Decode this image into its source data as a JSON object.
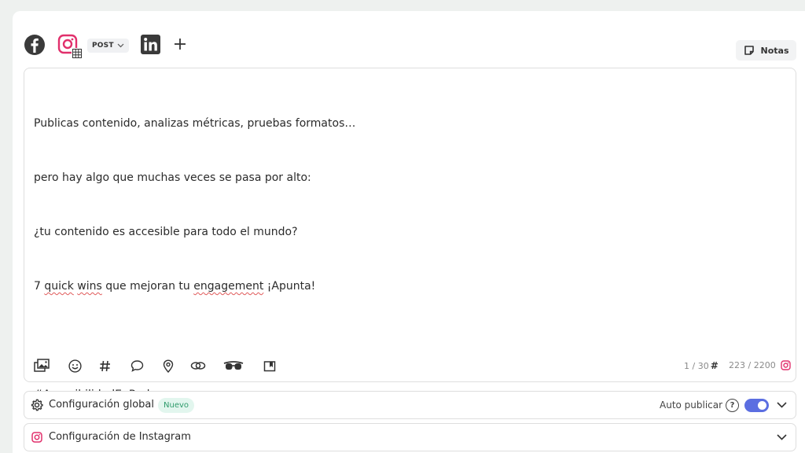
{
  "networks": {
    "facebook_icon": "facebook-icon",
    "instagram_icon": "instagram-icon",
    "instagram_color": "#e1306c",
    "post_type_label": "POST",
    "linkedin_icon": "linkedin-icon",
    "add_icon": "plus-icon"
  },
  "notes_button": {
    "label": "Notas"
  },
  "editor": {
    "lines": [
      "Publicas contenido, analizas métricas, pruebas formatos…",
      "pero hay algo que muchas veces se pasa por alto:",
      "¿tu contenido es accesible para todo el mundo?",
      "7 quick wins que mejoran tu engagement ¡Apunta!",
      "",
      "#AccesibilidadEnRedes"
    ],
    "line4_parts": [
      "7 ",
      "quick",
      " ",
      "wins",
      " que mejoran tu ",
      "engagement",
      " ¡Apunta!"
    ],
    "hashtag_count": "1 / 30",
    "char_count": "223 / 2200"
  },
  "toolbar": {
    "icons": [
      "media-icon",
      "emoji-icon",
      "hashtag-icon",
      "comment-icon",
      "location-icon",
      "link-icon",
      "ai-glasses-icon",
      "bookmark-icon"
    ]
  },
  "global_config": {
    "title": "Configuración global",
    "badge": "Nuevo",
    "auto_publish_label": "Auto publicar",
    "auto_publish_on": true,
    "accent_color": "#5b6ee1"
  },
  "instagram_config": {
    "title": "Configuración de Instagram"
  }
}
